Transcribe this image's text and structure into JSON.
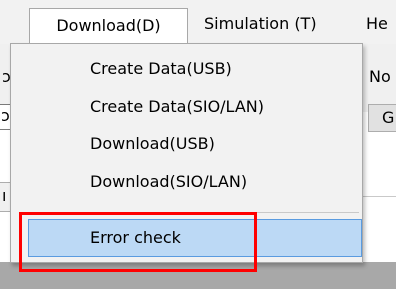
{
  "menubar": {
    "items": [
      {
        "label": "Download(D)",
        "state": "open"
      },
      {
        "label": "Simulation (T)"
      },
      {
        "label": "He"
      }
    ]
  },
  "background": {
    "fragments": [
      "ɔt",
      "ɔr",
      "No",
      "G",
      "ı S"
    ]
  },
  "dropdown": {
    "items": [
      {
        "label": "Create Data(USB)"
      },
      {
        "label": "Create Data(SIO/LAN)"
      },
      {
        "label": "Download(USB)"
      },
      {
        "label": "Download(SIO/LAN)"
      },
      {
        "label": "Error check",
        "state": "hovered"
      }
    ]
  },
  "colors": {
    "menu_bg": "#f2f2f2",
    "hover_bg": "#bcd9f5",
    "hover_border": "#5a9be0",
    "highlight": "#ff0000",
    "bottom_band": "#a8a8a8"
  }
}
